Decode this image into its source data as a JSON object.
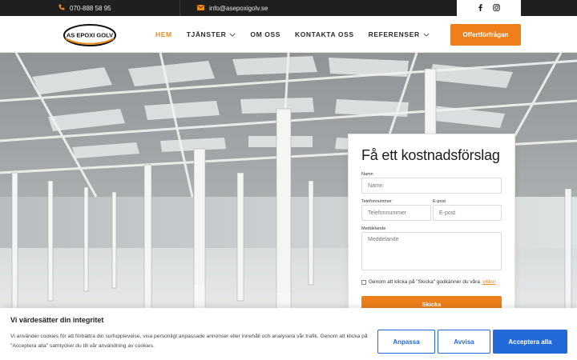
{
  "topbar": {
    "phone": "070-888 58 95",
    "email": "info@asepoxigolv.se",
    "phone_icon": "phone-icon",
    "email_icon": "envelope-icon",
    "social_icons": [
      "facebook-icon",
      "instagram-icon"
    ]
  },
  "logo": {
    "text": "AS EPOXI GOLV"
  },
  "nav": {
    "items": [
      {
        "label": "HEM",
        "active": true
      },
      {
        "label": "TJÄNSTER",
        "dropdown": true
      },
      {
        "label": "OM OSS"
      },
      {
        "label": "KONTAKTA OSS"
      },
      {
        "label": "REFERENSER",
        "dropdown": true
      }
    ],
    "cta": "Offertförfrågan"
  },
  "form": {
    "title": "Få ett kostnadsförslag",
    "name_label": "Namn",
    "name_placeholder": "Namn",
    "phone_label": "Telefonnummer",
    "phone_placeholder": "Telefonnummer",
    "email_label": "E-post",
    "email_placeholder": "E-post",
    "message_label": "Meddelande",
    "message_placeholder": "Meddelande",
    "consent_text": "Genom att klicka på \"Skicka\" godkänner du våra",
    "consent_link": "villkor",
    "submit": "Skicka"
  },
  "cookie": {
    "title": "Vi värdesätter din integritet",
    "text": "Vi använder cookies för att förbättra din surfupplevelse, visa personligt anpassade annonser eller innehåll och analysera vår trafik. Genom att klicka på \"Acceptera alla\" samtycker du till vår användning av cookies.",
    "customize": "Anpassa",
    "reject": "Avvisa",
    "accept": "Acceptera alla"
  },
  "colors": {
    "accent": "#ee7f1b",
    "topbar_bg": "#1f1f1f",
    "cookie_blue": "#2369d8"
  }
}
